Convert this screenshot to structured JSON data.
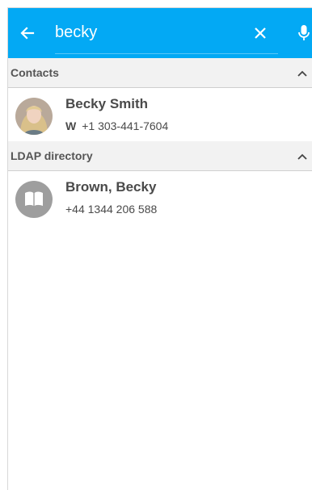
{
  "search": {
    "query": "becky",
    "back_icon": "arrow-left-icon",
    "clear_icon": "close-icon",
    "mic_icon": "microphone-icon",
    "accent_color": "#03a9f4"
  },
  "sections": {
    "contacts": {
      "title": "Contacts",
      "collapse_icon": "chevron-up-icon",
      "results": [
        {
          "name": "Becky Smith",
          "phone_type": "W",
          "phone": "+1 303-441-7604",
          "avatar": "photo-avatar"
        }
      ]
    },
    "ldap": {
      "title": "LDAP directory",
      "collapse_icon": "chevron-up-icon",
      "results": [
        {
          "name": "Brown, Becky",
          "phone": "+44 1344 206 588",
          "avatar": "directory-book-icon"
        }
      ]
    }
  }
}
